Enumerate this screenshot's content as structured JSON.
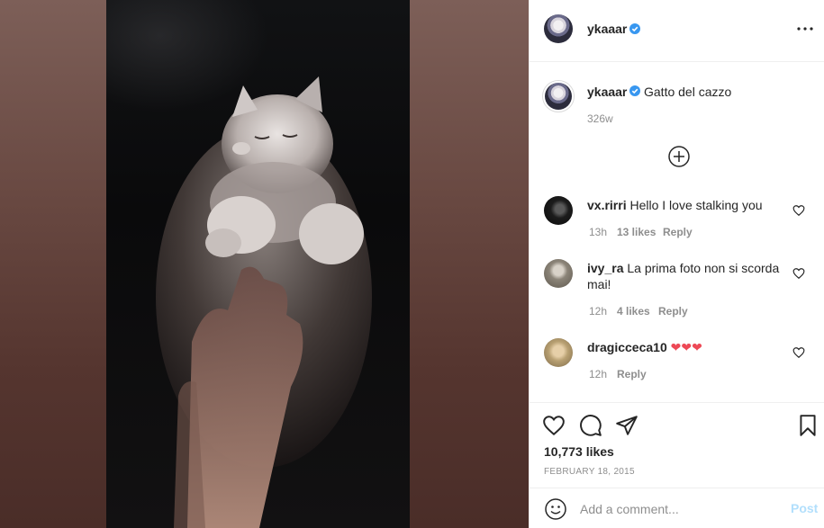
{
  "post": {
    "owner": "ykaaar",
    "caption": "Gatto del cazzo",
    "caption_age": "326w",
    "likes": "10,773 likes",
    "date": "FEBRUARY 18, 2015"
  },
  "comments": [
    {
      "user": "vx.rirri",
      "text": "Hello I love stalking you",
      "age": "13h",
      "likes": "13 likes",
      "reply": "Reply"
    },
    {
      "user": "ivy_ra",
      "text": "La prima foto non si scorda mai!",
      "age": "12h",
      "likes": "4 likes",
      "reply": "Reply"
    },
    {
      "user": "dragicceca10",
      "text": "❤❤❤",
      "age": "12h",
      "reply": "Reply"
    }
  ],
  "comment_form": {
    "placeholder": "Add a comment...",
    "post_label": "Post"
  },
  "colors": {
    "verified": "#3897f0",
    "link_disabled": "#b2dffc",
    "muted": "#8e8e8e",
    "heart_red": "#ed4956"
  },
  "icons": [
    "more-icon",
    "verified-icon",
    "load-more-icon",
    "heart-icon",
    "comment-icon",
    "share-icon",
    "bookmark-icon",
    "emoji-icon"
  ]
}
